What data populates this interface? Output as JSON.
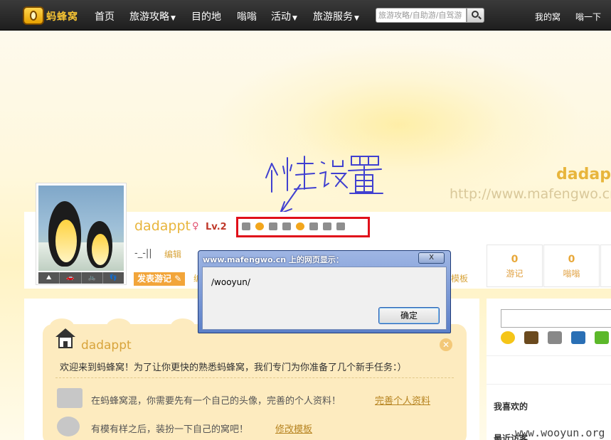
{
  "nav": {
    "logo_text": "蚂蜂窝",
    "items": [
      {
        "label": "首页",
        "dropdown": false
      },
      {
        "label": "旅游攻略",
        "dropdown": true
      },
      {
        "label": "目的地",
        "dropdown": false
      },
      {
        "label": "嗡嗡",
        "dropdown": false
      },
      {
        "label": "活动",
        "dropdown": true
      },
      {
        "label": "旅游服务",
        "dropdown": true
      }
    ],
    "search_placeholder": "旅游攻略/自助游/自驾游",
    "right_links": [
      "我的窝",
      "嗡一下"
    ]
  },
  "banner": {
    "username": "dadappt",
    "url": "http://www.mafengwo.cn/"
  },
  "annotation": {
    "handwritten_text": "个性设置",
    "highlight_color": "#e0101a"
  },
  "profile": {
    "username": "dadappt",
    "gender_symbol": "♀",
    "level": "Lv.2",
    "signature": "-_-||",
    "edit_label": "编辑",
    "post_button": "发表游记",
    "post_partial": "编",
    "template_label": "模板",
    "avatar_tools": [
      "⛰",
      "🚗",
      "🚲",
      "👣"
    ],
    "stats": [
      {
        "value": "0",
        "label": "游记"
      },
      {
        "value": "0",
        "label": "嗡嗡"
      }
    ]
  },
  "welcome": {
    "title": "dadappt",
    "intro": "欢迎来到蚂蜂窝！为了让你更快的熟悉蚂蜂窝，我们专门为你准备了几个新手任务：）",
    "tasks": [
      {
        "text": "在蚂蜂窝混，你需要先有一个自己的头像，完善的个人资料！",
        "link": "完善个人资料"
      },
      {
        "text": "有模有样之后，装扮一下自己的窝吧！",
        "link": "修改模板"
      }
    ]
  },
  "sidebar": {
    "heading": "我喜欢的",
    "heading2": "最近访客"
  },
  "dialog": {
    "title": "www.mafengwo.cn 上的网页显示：",
    "close": "X",
    "message": "/wooyun/",
    "ok": "确定"
  },
  "watermark": "www.wooyun.org"
}
